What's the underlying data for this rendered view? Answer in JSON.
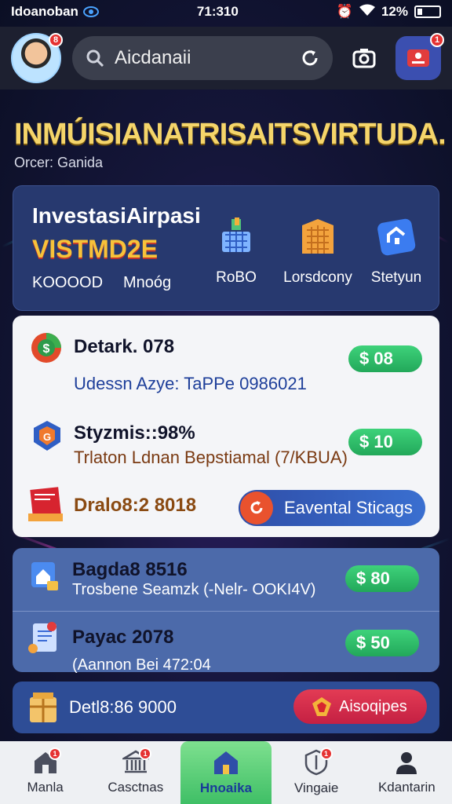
{
  "status_bar": {
    "carrier": "Idoanoban",
    "time": "71:310",
    "battery": "12%"
  },
  "header": {
    "avatar_badge": "8",
    "search_value": "Aicdanaii",
    "notification_badge": "1"
  },
  "headline": {
    "title": "INMÚISIANATRISAITSVIRTUDA.",
    "subtitle": "Orcer: Ganida"
  },
  "investment": {
    "title": "InvestasiAirpasi",
    "promo": "VISTMD2E",
    "code": "KOOOOD",
    "menu": "Mnoóg",
    "categories": [
      {
        "label": "RoBO",
        "icon": "basket-icon"
      },
      {
        "label": "Lorsdcony",
        "icon": "building-icon"
      },
      {
        "label": "Stetyun",
        "icon": "house-icon"
      }
    ]
  },
  "list_white": [
    {
      "title": "Detark. 078",
      "subtitle": "Udessn Azye:  TaPPe 0986021",
      "amount": "$ 08",
      "icon": "dollar-circle-icon"
    },
    {
      "title": "Styzmis::98%",
      "subtitle": "Trlaton Ldnan Bepstiamal (7/KBUA)",
      "amount": "$ 10",
      "icon": "shield-icon"
    },
    {
      "title": "Dralo8:2 8018",
      "button": "Eavental Sticags",
      "icon": "gift-box-icon"
    }
  ],
  "list_blue": [
    {
      "title": "Bagda8 8516",
      "subtitle": "Trosbene Seamzk (-Nelr- OOKI4V)",
      "amount": "$ 80",
      "icon": "home-card-icon"
    },
    {
      "title": "Payac 2078",
      "subtitle": "(Aannon Bei 472:04",
      "amount": "$ 50",
      "icon": "document-icon"
    }
  ],
  "last_row": {
    "title": "Detl8:86 9000",
    "button": "Aisoqipes",
    "icon": "treasure-icon"
  },
  "bottom_nav": [
    {
      "label": "Manla",
      "icon": "house-icon",
      "badge": "1",
      "active": false
    },
    {
      "label": "Casctnas",
      "icon": "bank-icon",
      "badge": "1",
      "active": false
    },
    {
      "label": "Hnoaika",
      "icon": "home-icon",
      "badge": "",
      "active": true
    },
    {
      "label": "Vingaie",
      "icon": "shield-icon",
      "badge": "1",
      "active": false
    },
    {
      "label": "Kdantarin",
      "icon": "user-icon",
      "badge": "",
      "active": false
    }
  ],
  "colors": {
    "accent_green": "#3ed27a",
    "accent_blue": "#2f4ea8",
    "accent_red": "#e33b54",
    "gold": "#f5d56a"
  }
}
